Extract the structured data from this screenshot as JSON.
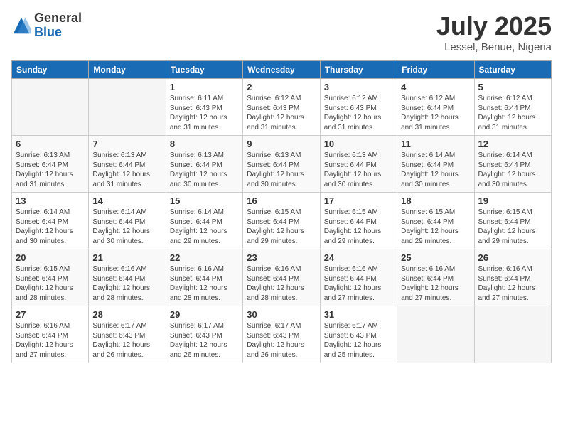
{
  "logo": {
    "general": "General",
    "blue": "Blue"
  },
  "header": {
    "month_year": "July 2025",
    "location": "Lessel, Benue, Nigeria"
  },
  "weekdays": [
    "Sunday",
    "Monday",
    "Tuesday",
    "Wednesday",
    "Thursday",
    "Friday",
    "Saturday"
  ],
  "weeks": [
    [
      {
        "day": "",
        "info": ""
      },
      {
        "day": "",
        "info": ""
      },
      {
        "day": "1",
        "info": "Sunrise: 6:11 AM\nSunset: 6:43 PM\nDaylight: 12 hours and 31 minutes."
      },
      {
        "day": "2",
        "info": "Sunrise: 6:12 AM\nSunset: 6:43 PM\nDaylight: 12 hours and 31 minutes."
      },
      {
        "day": "3",
        "info": "Sunrise: 6:12 AM\nSunset: 6:43 PM\nDaylight: 12 hours and 31 minutes."
      },
      {
        "day": "4",
        "info": "Sunrise: 6:12 AM\nSunset: 6:44 PM\nDaylight: 12 hours and 31 minutes."
      },
      {
        "day": "5",
        "info": "Sunrise: 6:12 AM\nSunset: 6:44 PM\nDaylight: 12 hours and 31 minutes."
      }
    ],
    [
      {
        "day": "6",
        "info": "Sunrise: 6:13 AM\nSunset: 6:44 PM\nDaylight: 12 hours and 31 minutes."
      },
      {
        "day": "7",
        "info": "Sunrise: 6:13 AM\nSunset: 6:44 PM\nDaylight: 12 hours and 31 minutes."
      },
      {
        "day": "8",
        "info": "Sunrise: 6:13 AM\nSunset: 6:44 PM\nDaylight: 12 hours and 30 minutes."
      },
      {
        "day": "9",
        "info": "Sunrise: 6:13 AM\nSunset: 6:44 PM\nDaylight: 12 hours and 30 minutes."
      },
      {
        "day": "10",
        "info": "Sunrise: 6:13 AM\nSunset: 6:44 PM\nDaylight: 12 hours and 30 minutes."
      },
      {
        "day": "11",
        "info": "Sunrise: 6:14 AM\nSunset: 6:44 PM\nDaylight: 12 hours and 30 minutes."
      },
      {
        "day": "12",
        "info": "Sunrise: 6:14 AM\nSunset: 6:44 PM\nDaylight: 12 hours and 30 minutes."
      }
    ],
    [
      {
        "day": "13",
        "info": "Sunrise: 6:14 AM\nSunset: 6:44 PM\nDaylight: 12 hours and 30 minutes."
      },
      {
        "day": "14",
        "info": "Sunrise: 6:14 AM\nSunset: 6:44 PM\nDaylight: 12 hours and 30 minutes."
      },
      {
        "day": "15",
        "info": "Sunrise: 6:14 AM\nSunset: 6:44 PM\nDaylight: 12 hours and 29 minutes."
      },
      {
        "day": "16",
        "info": "Sunrise: 6:15 AM\nSunset: 6:44 PM\nDaylight: 12 hours and 29 minutes."
      },
      {
        "day": "17",
        "info": "Sunrise: 6:15 AM\nSunset: 6:44 PM\nDaylight: 12 hours and 29 minutes."
      },
      {
        "day": "18",
        "info": "Sunrise: 6:15 AM\nSunset: 6:44 PM\nDaylight: 12 hours and 29 minutes."
      },
      {
        "day": "19",
        "info": "Sunrise: 6:15 AM\nSunset: 6:44 PM\nDaylight: 12 hours and 29 minutes."
      }
    ],
    [
      {
        "day": "20",
        "info": "Sunrise: 6:15 AM\nSunset: 6:44 PM\nDaylight: 12 hours and 28 minutes."
      },
      {
        "day": "21",
        "info": "Sunrise: 6:16 AM\nSunset: 6:44 PM\nDaylight: 12 hours and 28 minutes."
      },
      {
        "day": "22",
        "info": "Sunrise: 6:16 AM\nSunset: 6:44 PM\nDaylight: 12 hours and 28 minutes."
      },
      {
        "day": "23",
        "info": "Sunrise: 6:16 AM\nSunset: 6:44 PM\nDaylight: 12 hours and 28 minutes."
      },
      {
        "day": "24",
        "info": "Sunrise: 6:16 AM\nSunset: 6:44 PM\nDaylight: 12 hours and 27 minutes."
      },
      {
        "day": "25",
        "info": "Sunrise: 6:16 AM\nSunset: 6:44 PM\nDaylight: 12 hours and 27 minutes."
      },
      {
        "day": "26",
        "info": "Sunrise: 6:16 AM\nSunset: 6:44 PM\nDaylight: 12 hours and 27 minutes."
      }
    ],
    [
      {
        "day": "27",
        "info": "Sunrise: 6:16 AM\nSunset: 6:44 PM\nDaylight: 12 hours and 27 minutes."
      },
      {
        "day": "28",
        "info": "Sunrise: 6:17 AM\nSunset: 6:43 PM\nDaylight: 12 hours and 26 minutes."
      },
      {
        "day": "29",
        "info": "Sunrise: 6:17 AM\nSunset: 6:43 PM\nDaylight: 12 hours and 26 minutes."
      },
      {
        "day": "30",
        "info": "Sunrise: 6:17 AM\nSunset: 6:43 PM\nDaylight: 12 hours and 26 minutes."
      },
      {
        "day": "31",
        "info": "Sunrise: 6:17 AM\nSunset: 6:43 PM\nDaylight: 12 hours and 25 minutes."
      },
      {
        "day": "",
        "info": ""
      },
      {
        "day": "",
        "info": ""
      }
    ]
  ]
}
